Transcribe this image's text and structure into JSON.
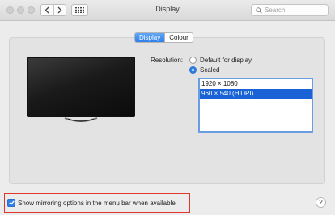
{
  "window": {
    "title": "Display"
  },
  "toolbar": {
    "search_placeholder": "Search"
  },
  "tabs": [
    {
      "label": "Display",
      "active": true
    },
    {
      "label": "Colour",
      "active": false
    }
  ],
  "resolution": {
    "label": "Resolution:",
    "options": [
      {
        "label": "Default for display",
        "selected": false
      },
      {
        "label": "Scaled",
        "selected": true
      }
    ],
    "scaled_list": [
      {
        "label": "1920 × 1080",
        "selected": false
      },
      {
        "label": "960 × 540 (HiDPI)",
        "selected": true
      }
    ]
  },
  "footer": {
    "mirroring_label": "Show mirroring options in the menu bar when available",
    "mirroring_checked": true,
    "help_label": "?"
  },
  "colors": {
    "accent": "#2f7fea",
    "highlight_border": "#e0362c"
  }
}
